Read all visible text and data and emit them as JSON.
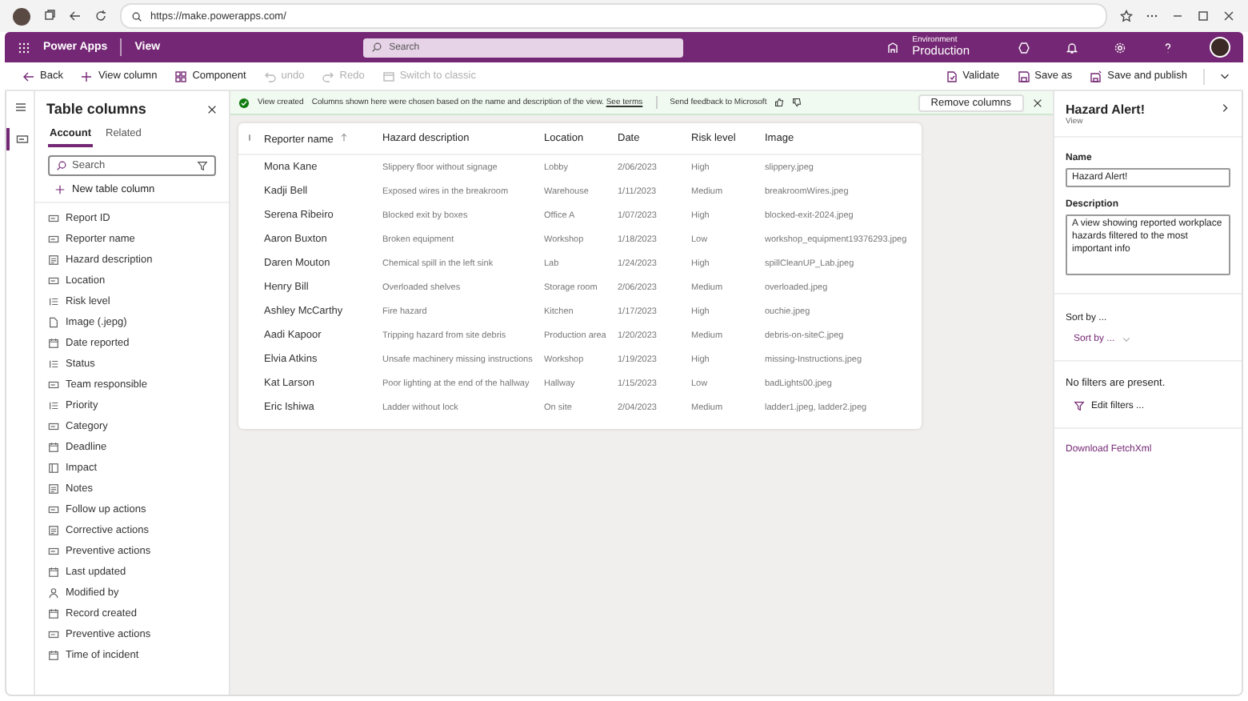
{
  "browser": {
    "url": "https://make.powerapps.com/"
  },
  "header": {
    "app_name": "Power Apps",
    "page": "View",
    "search_placeholder": "Search",
    "environment_label": "Environment",
    "environment": "Production"
  },
  "toolbar": {
    "left": [
      {
        "label": "Back",
        "kind": "back",
        "disabled": false
      },
      {
        "label": "View column",
        "kind": "add",
        "disabled": false
      },
      {
        "label": "Component",
        "kind": "component",
        "disabled": false
      },
      {
        "label": "undo",
        "kind": "undo",
        "disabled": true
      },
      {
        "label": "Redo",
        "kind": "redo",
        "disabled": true
      },
      {
        "label": "Switch to classic",
        "kind": "classic",
        "disabled": true
      }
    ],
    "right": [
      {
        "label": "Validate",
        "kind": "validate",
        "disabled": false
      },
      {
        "label": "Save as",
        "kind": "save",
        "disabled": false
      },
      {
        "label": "Save and publish",
        "kind": "publish",
        "disabled": false
      }
    ]
  },
  "columns_pane": {
    "title": "Table columns",
    "tabs": [
      {
        "label": "Account",
        "selected": true
      },
      {
        "label": "Related",
        "selected": false
      }
    ],
    "search_placeholder": "Search",
    "new_column": "New table column",
    "items": [
      {
        "label": "Report ID",
        "kind": "text"
      },
      {
        "label": "Reporter name",
        "kind": "text"
      },
      {
        "label": "Hazard description",
        "kind": "multiline"
      },
      {
        "label": "Location",
        "kind": "text"
      },
      {
        "label": "Risk level",
        "kind": "choice"
      },
      {
        "label": "Image (.jepg)",
        "kind": "file"
      },
      {
        "label": "Date reported",
        "kind": "date"
      },
      {
        "label": "Status",
        "kind": "choice"
      },
      {
        "label": "Team responsible",
        "kind": "text"
      },
      {
        "label": "Priority",
        "kind": "choice"
      },
      {
        "label": "Category",
        "kind": "text"
      },
      {
        "label": "Deadline",
        "kind": "date"
      },
      {
        "label": "Impact",
        "kind": "number"
      },
      {
        "label": "Notes",
        "kind": "multiline"
      },
      {
        "label": "Follow up actions",
        "kind": "text"
      },
      {
        "label": "Corrective actions",
        "kind": "multiline"
      },
      {
        "label": "Preventive actions",
        "kind": "text"
      },
      {
        "label": "Last updated",
        "kind": "date"
      },
      {
        "label": "Modified by",
        "kind": "person"
      },
      {
        "label": "Record created",
        "kind": "date"
      },
      {
        "label": "Preventive actions",
        "kind": "text"
      },
      {
        "label": "Time of incident",
        "kind": "date"
      }
    ]
  },
  "notification": {
    "title": "View created",
    "message": "Columns shown here were chosen based on the name and description of the view.",
    "link": "See terms",
    "feedback": "Send feedback to Microsoft",
    "action": "Remove columns"
  },
  "table": {
    "columns": [
      {
        "label": "Reporter name",
        "sorted": true
      },
      {
        "label": "Hazard description",
        "sorted": false
      },
      {
        "label": "Location",
        "sorted": false
      },
      {
        "label": "Date",
        "sorted": false
      },
      {
        "label": "Risk level",
        "sorted": false
      },
      {
        "label": "Image",
        "sorted": false
      }
    ],
    "rows": [
      [
        "Mona Kane",
        "Slippery floor without signage",
        "Lobby",
        "2/06/2023",
        "High",
        "slippery.jpeg"
      ],
      [
        "Kadji Bell",
        "Exposed wires in the breakroom",
        "Warehouse",
        "1/11/2023",
        "Medium",
        "breakroomWires.jpeg"
      ],
      [
        "Serena Ribeiro",
        "Blocked exit by boxes",
        "Office A",
        "1/07/2023",
        "High",
        "blocked-exit-2024.jpeg"
      ],
      [
        "Aaron Buxton",
        "Broken equipment",
        "Workshop",
        "1/18/2023",
        "Low",
        "workshop_equipment19376293.jpeg"
      ],
      [
        "Daren Mouton",
        "Chemical spill in the left sink",
        "Lab",
        "1/24/2023",
        "High",
        "spillCleanUP_Lab.jpeg"
      ],
      [
        "Henry Bill",
        "Overloaded shelves",
        "Storage room",
        "2/06/2023",
        "Medium",
        "overloaded.jpeg"
      ],
      [
        "Ashley McCarthy",
        "Fire hazard",
        "Kitchen",
        "1/17/2023",
        "High",
        "ouchie.jpeg"
      ],
      [
        "Aadi Kapoor",
        "Tripping hazard from site debris",
        "Production area",
        "1/20/2023",
        "Medium",
        "debris-on-siteC.jpeg"
      ],
      [
        "Elvia Atkins",
        "Unsafe machinery missing instructions",
        "Workshop",
        "1/19/2023",
        "High",
        "missing-Instructions.jpeg"
      ],
      [
        "Kat Larson",
        "Poor lighting at the end of the hallway",
        "Hallway",
        "1/15/2023",
        "Low",
        "badLights00.jpeg"
      ],
      [
        "Eric Ishiwa",
        "Ladder without lock",
        "On site",
        "2/04/2023",
        "Medium",
        "ladder1.jpeg, ladder2.jpeg"
      ]
    ]
  },
  "properties": {
    "title": "Hazard Alert!",
    "subtitle": "View",
    "name_label": "Name",
    "name_value": "Hazard Alert!",
    "description_label": "Description",
    "description_value": "A view showing reported workplace hazards filtered to the most important info",
    "sort_label": "Sort by ...",
    "sort_button": "Sort by ...",
    "filters_note": "No filters are present.",
    "edit_filters": "Edit filters ...",
    "download": "Download FetchXml"
  }
}
